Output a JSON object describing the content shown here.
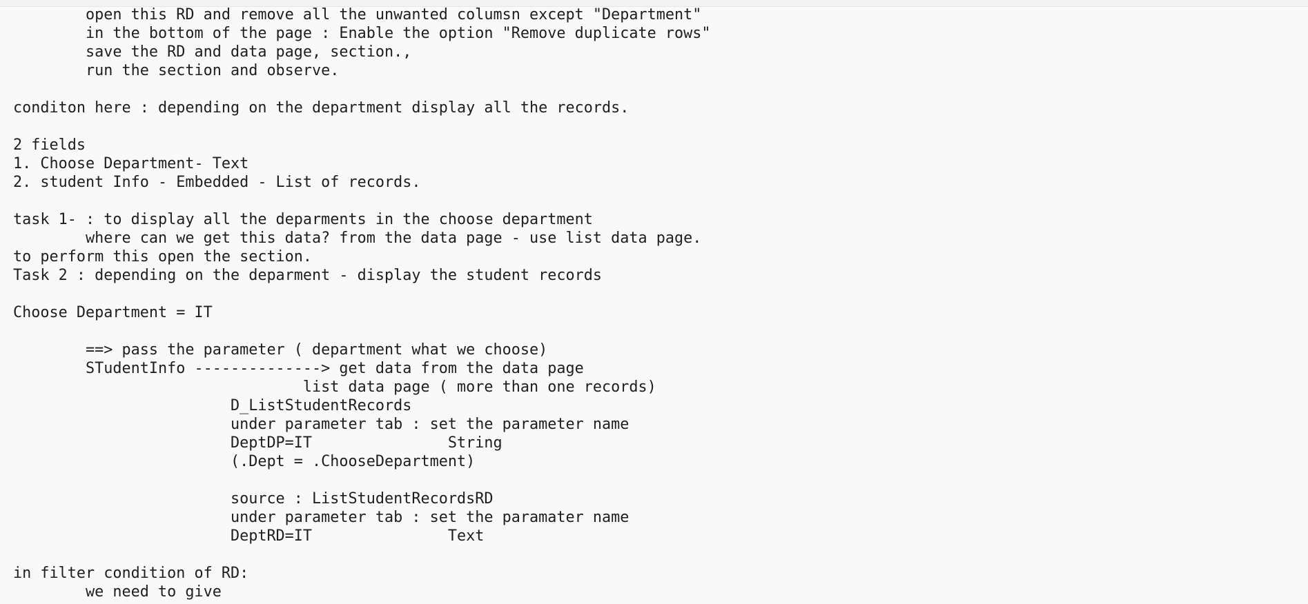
{
  "editor": {
    "lines": [
      "        open this RD and remove all the unwanted columsn except \"Department\"",
      "        in the bottom of the page : Enable the option \"Remove duplicate rows\"",
      "        save the RD and data page, section.,",
      "        run the section and observe.",
      "",
      "conditon here : depending on the department display all the records.",
      "",
      "2 fields",
      "1. Choose Department- Text",
      "2. student Info - Embedded - List of records.",
      "",
      "task 1- : to display all the deparments in the choose department",
      "        where can we get this data? from the data page - use list data page.",
      "to perform this open the section.",
      "Task 2 : depending on the deparment - display the student records",
      "",
      "Choose Department = IT",
      "",
      "        ==> pass the parameter ( department what we choose)",
      "        STudentInfo --------------> get data from the data page",
      "                                list data page ( more than one records)",
      "                        D_ListStudentRecords",
      "                        under parameter tab : set the parameter name",
      "                        DeptDP=IT               String",
      "                        (.Dept = .ChooseDepartment)",
      "",
      "                        source : ListStudentRecordsRD",
      "                        under parameter tab : set the paramater name",
      "                        DeptRD=IT               Text",
      "",
      "in filter condition of RD:",
      "        we need to give"
    ]
  }
}
